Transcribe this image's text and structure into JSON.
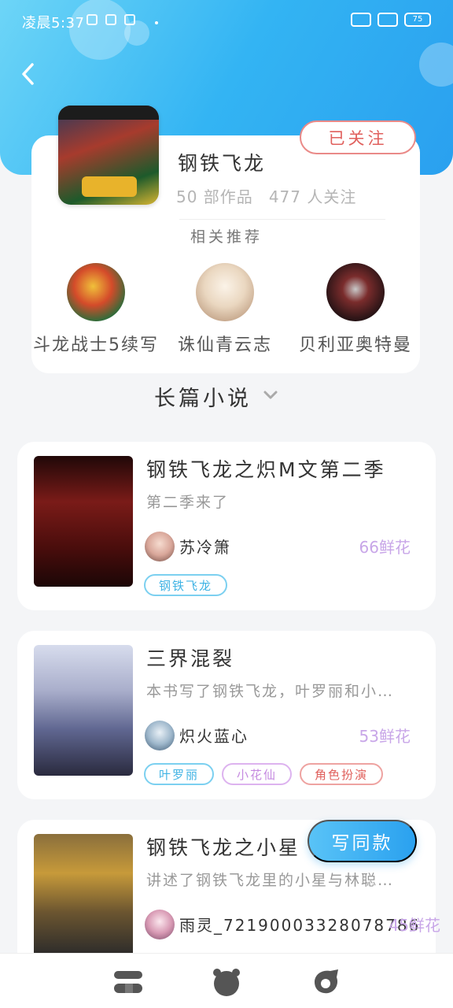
{
  "status_bar": {
    "time": "凌晨5:37",
    "battery": "75"
  },
  "profile": {
    "name": "钢铁飞龙",
    "works": "50 部作品",
    "followers": "477 人关注",
    "follow_label": "已关注"
  },
  "related": {
    "title": "相关推荐",
    "items": [
      {
        "label": "斗龙战士5续写"
      },
      {
        "label": "诛仙青云志"
      },
      {
        "label": "贝利亚奥特曼"
      }
    ]
  },
  "section": {
    "title": "长篇小说"
  },
  "works": [
    {
      "title": "钢铁飞龙之炽M文第二季",
      "desc": "第二季来了",
      "author": "苏冷箫",
      "flowers": "66鲜花",
      "tags": [
        "钢铁飞龙"
      ]
    },
    {
      "title": "三界混裂",
      "desc": "本书写了钢铁飞龙，叶罗丽和小…",
      "author": "炽火蓝心",
      "flowers": "53鲜花",
      "tags": [
        "叶罗丽",
        "小花仙",
        "角色扮演"
      ]
    },
    {
      "title": "钢铁飞龙之小星",
      "desc": "讲述了钢铁飞龙里的小星与林聪…",
      "author": "雨灵_72190003328078786",
      "flowers": "45鲜花",
      "tags": []
    }
  ],
  "write_button": "写同款",
  "colors": {
    "accent": "#2aa1ef",
    "follow": "#e0605d",
    "flowers": "#c8a6e8"
  },
  "icons": {
    "back": "chevron-left-icon",
    "dropdown": "chevron-down-icon",
    "nav": [
      "home-icon",
      "discover-icon",
      "profile-icon"
    ]
  }
}
